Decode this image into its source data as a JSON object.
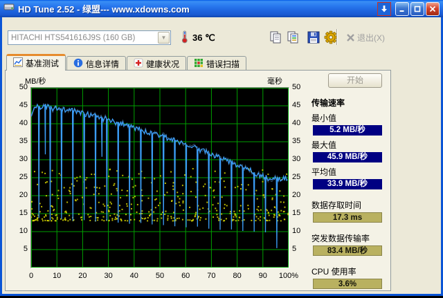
{
  "window": {
    "title": "HD Tune 2.52 - 绿盟--- www.xdowns.com"
  },
  "toolbar": {
    "drive": "HITACHI HTS541616J9S (160 GB)",
    "temperature_value": "36",
    "temperature_unit": "℃",
    "exit_label": "退出(X)"
  },
  "tabs": [
    {
      "label": "基准测试",
      "icon": "benchmark-icon",
      "active": true
    },
    {
      "label": "信息详情",
      "icon": "info-icon",
      "active": false
    },
    {
      "label": "健康状况",
      "icon": "health-icon",
      "active": false
    },
    {
      "label": "错误扫描",
      "icon": "error-scan-icon",
      "active": false
    }
  ],
  "panel": {
    "start_button": "开始",
    "transfer_title": "传输速率",
    "transfer_stats": [
      {
        "label": "最小值",
        "value": "5.2 MB/秒"
      },
      {
        "label": "最大值",
        "value": "45.9 MB/秒"
      },
      {
        "label": "平均值",
        "value": "33.9 MB/秒"
      }
    ],
    "other_stats": [
      {
        "label": "数据存取时间",
        "value": "17.3 ms"
      },
      {
        "label": "突发数据传输率",
        "value": "83.4 MB/秒"
      },
      {
        "label": "CPU 使用率",
        "value": "3.6%"
      }
    ]
  },
  "chart_data": {
    "type": "line+scatter",
    "title": "基准测试",
    "plot_bg": "#000000",
    "grid_color": "#00a000",
    "seed": 20252,
    "x_axis": {
      "min": 0,
      "max": 100,
      "values": [
        0,
        10,
        20,
        30,
        40,
        50,
        60,
        70,
        80,
        90,
        100
      ],
      "labels": [
        "0",
        "10",
        "20",
        "30",
        "40",
        "50",
        "60",
        "70",
        "80",
        "90",
        "100%"
      ]
    },
    "y_axis": {
      "render_min": 0,
      "render_max": 50,
      "values": [
        50,
        45,
        40,
        35,
        30,
        25,
        20,
        15,
        10,
        5
      ],
      "labels": [
        "50",
        "45",
        "40",
        "35",
        "30",
        "25",
        "20",
        "15",
        "10",
        "5"
      ],
      "left_unit": "MB/秒",
      "right_unit": "毫秒"
    },
    "series": [
      {
        "name": "transfer-rate",
        "type": "line",
        "color": "#3b9cf5",
        "noise": 1.5,
        "baseline": [
          [
            0,
            42.5
          ],
          [
            1,
            44.2
          ],
          [
            2,
            44.9
          ],
          [
            3.6,
            44.4
          ],
          [
            5,
            45.4
          ],
          [
            6,
            44.8
          ],
          [
            8,
            44.3
          ],
          [
            10,
            44.5
          ],
          [
            12,
            43.9
          ],
          [
            14,
            43.6
          ],
          [
            16,
            43.8
          ],
          [
            18,
            43.2
          ],
          [
            20,
            42.9
          ],
          [
            22,
            42.6
          ],
          [
            24,
            42.2
          ],
          [
            26,
            41.9
          ],
          [
            28,
            41.5
          ],
          [
            30,
            41.2
          ],
          [
            32,
            40.7
          ],
          [
            34,
            40.3
          ],
          [
            36,
            39.9
          ],
          [
            38,
            39.4
          ],
          [
            40,
            38.9
          ],
          [
            42,
            38.5
          ],
          [
            44,
            38
          ],
          [
            46,
            37.6
          ],
          [
            48,
            37.1
          ],
          [
            50,
            36.7
          ],
          [
            52,
            36.2
          ],
          [
            54,
            35.7
          ],
          [
            56,
            35.2
          ],
          [
            58,
            34.7
          ],
          [
            60,
            34.2
          ],
          [
            62,
            33.7
          ],
          [
            64,
            33.1
          ],
          [
            66,
            32.6
          ],
          [
            68,
            32
          ],
          [
            70,
            31.5
          ],
          [
            72,
            30.9
          ],
          [
            74,
            30.3
          ],
          [
            76,
            29.7
          ],
          [
            78,
            29.1
          ],
          [
            80,
            28.5
          ],
          [
            82,
            27.9
          ],
          [
            84,
            27.3
          ],
          [
            86,
            26.7
          ],
          [
            88,
            26
          ],
          [
            90,
            25.4
          ],
          [
            92,
            25
          ],
          [
            94,
            24.7
          ],
          [
            96,
            24.5
          ],
          [
            98,
            24.8
          ],
          [
            100,
            25.1
          ]
        ],
        "dips": [
          [
            3,
            13.8
          ],
          [
            7.4,
            13.2
          ],
          [
            11.8,
            13.5
          ],
          [
            16.2,
            13
          ],
          [
            20.6,
            13.2
          ],
          [
            25,
            12.8
          ],
          [
            29.4,
            13
          ],
          [
            33.8,
            12.5
          ],
          [
            38.2,
            12.2
          ],
          [
            42.6,
            12.4
          ],
          [
            47,
            12
          ],
          [
            51.4,
            11.8
          ],
          [
            55.8,
            11.5
          ],
          [
            60.2,
            11.2
          ],
          [
            64.6,
            11.4
          ],
          [
            69,
            10.8
          ],
          [
            73.4,
            10.5
          ],
          [
            77.8,
            10.6
          ],
          [
            82.2,
            10.2
          ],
          [
            86.6,
            10
          ],
          [
            91,
            9.8
          ],
          [
            95.4,
            5.4
          ],
          [
            5.5,
            31.5
          ],
          [
            27.5,
            30.8
          ]
        ]
      },
      {
        "name": "access-time",
        "type": "scatter",
        "color": "#d8d800",
        "count": 430,
        "y_min": 13,
        "y_max": 27.5,
        "skew": 2.1
      }
    ],
    "results": {
      "min_mbs": 5.2,
      "max_mbs": 45.9,
      "avg_mbs": 33.9,
      "access_ms": 17.3,
      "burst_mbs": 83.4,
      "cpu_pct": 3.6
    }
  }
}
